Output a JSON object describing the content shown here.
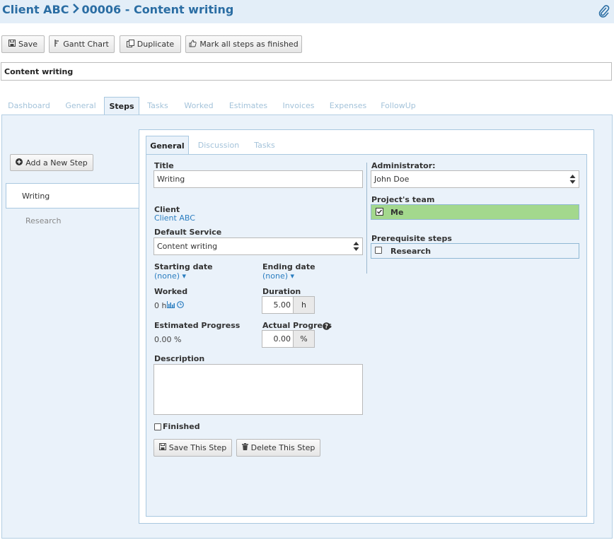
{
  "breadcrumb": {
    "client": "Client ABC",
    "project": "00006 - Content writing"
  },
  "icons": {
    "attach": "paperclip-icon",
    "save": "floppy-icon",
    "gantt": "gantt-icon",
    "duplicate": "copy-icon",
    "finish_all": "thumbs-up-icon",
    "add_step": "plus-circle-icon",
    "statistics": "bar-chart-icon",
    "clock": "clock-icon",
    "help": "question-circle-icon",
    "delete": "trash-icon"
  },
  "toolbar": {
    "save": "Save",
    "gantt": "Gantt Chart",
    "duplicate": "Duplicate",
    "mark_finished": "Mark all steps as finished"
  },
  "project_name": "Content writing",
  "main_tabs": {
    "dashboard": "Dashboard",
    "general": "General",
    "steps": "Steps",
    "tasks": "Tasks",
    "worked": "Worked",
    "estimates": "Estimates",
    "invoices": "Invoices",
    "expenses": "Expenses",
    "followup": "FollowUp"
  },
  "add_step_label": "Add a New Step",
  "steps": {
    "active": "Writing",
    "other": "Research"
  },
  "step_tabs": {
    "general": "General",
    "discussion": "Discussion",
    "tasks": "Tasks"
  },
  "form": {
    "title_label": "Title",
    "title_value": "Writing",
    "client_label": "Client",
    "client_value": "Client ABC",
    "service_label": "Default Service",
    "service_value": "Content writing",
    "start_label": "Starting date",
    "start_value": "(none)",
    "end_label": "Ending date",
    "end_value": "(none)",
    "worked_label": "Worked",
    "worked_value": "0 h",
    "duration_label": "Duration",
    "duration_value": "5.00",
    "duration_unit": "h",
    "est_progress_label": "Estimated Progress",
    "est_progress_value": "0.00 %",
    "actual_progress_label": "Actual Progress",
    "actual_progress_value": "0.00",
    "actual_progress_unit": "%",
    "description_label": "Description",
    "finished_label": "Finished",
    "save_step": "Save This Step",
    "delete_step": "Delete This Step"
  },
  "right": {
    "admin_label": "Administrator:",
    "admin_value": "John Doe",
    "team_label": "Project's team",
    "team_member": "Me",
    "prereq_label": "Prerequisite steps",
    "prereq_item": "Research"
  },
  "colors": {
    "accent": "#2a6da3",
    "panel": "#eaf2fa",
    "team_selected": "#a3d88d",
    "link": "#2a7dc0"
  }
}
